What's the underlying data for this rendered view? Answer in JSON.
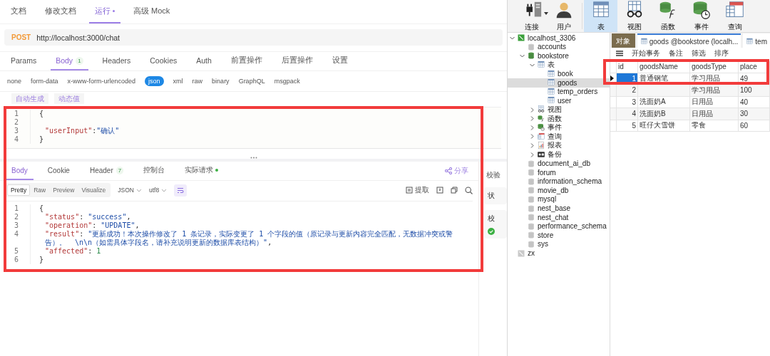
{
  "api_client": {
    "doc_tabs": [
      {
        "label": "文档",
        "selected": false,
        "dot": false
      },
      {
        "label": "修改文档",
        "selected": false,
        "dot": false
      },
      {
        "label": "运行",
        "selected": true,
        "dot": true
      },
      {
        "label": "高级 Mock",
        "selected": false,
        "dot": false
      }
    ],
    "request": {
      "method": "POST",
      "url": "http://localhost:3000/chat"
    },
    "request_tabs": [
      {
        "label": "Params",
        "selected": false
      },
      {
        "label": "Body",
        "badge": "1",
        "selected": true
      },
      {
        "label": "Headers",
        "selected": false
      },
      {
        "label": "Cookies",
        "selected": false
      },
      {
        "label": "Auth",
        "selected": false
      },
      {
        "label": "前置操作",
        "selected": false
      },
      {
        "label": "后置操作",
        "selected": false
      },
      {
        "label": "设置",
        "selected": false
      }
    ],
    "body_types": [
      {
        "label": "none",
        "selected": false
      },
      {
        "label": "form-data",
        "selected": false
      },
      {
        "label": "x-www-form-urlencoded",
        "selected": false
      },
      {
        "label": "json",
        "selected": true
      },
      {
        "label": "xml",
        "selected": false
      },
      {
        "label": "raw",
        "selected": false
      },
      {
        "label": "binary",
        "selected": false
      },
      {
        "label": "GraphQL",
        "selected": false
      },
      {
        "label": "msgpack",
        "selected": false
      }
    ],
    "body_buttons": [
      "自动生成",
      "动态值"
    ],
    "request_body": [
      {
        "num": "1",
        "text": "{"
      },
      {
        "num": "2"
      },
      {
        "num": "3",
        "key": "\"userInput\"",
        "sep": ":",
        "value": "\"确认\""
      },
      {
        "num": "4",
        "text": "}"
      }
    ],
    "response_tabs": [
      {
        "label": "Body",
        "selected": true,
        "dot": false
      },
      {
        "label": "Cookie",
        "selected": false,
        "dot": false
      },
      {
        "label": "Header",
        "badge": "7",
        "selected": false,
        "dot": false
      },
      {
        "label": "控制台",
        "selected": false,
        "dot": false
      },
      {
        "label": "实际请求",
        "selected": false,
        "dot": true
      }
    ],
    "share": "分享",
    "view_modes": [
      {
        "label": "Pretty",
        "selected": true
      },
      {
        "label": "Raw",
        "selected": false
      },
      {
        "label": "Preview",
        "selected": false
      },
      {
        "label": "Visualize",
        "selected": false
      }
    ],
    "format": "JSON",
    "encoding": "utf8",
    "extract": "提取",
    "response_body": [
      {
        "num": "1",
        "text": "{"
      },
      {
        "num": "2",
        "key": "\"status\"",
        "sep": ": ",
        "value": "\"success\"",
        "tail": ","
      },
      {
        "num": "3",
        "key": "\"operation\"",
        "sep": ": ",
        "value": "\"UPDATE\"",
        "tail": ","
      },
      {
        "num": "4",
        "key": "\"result\"",
        "sep": ": ",
        "value": "\"更新成功！本次操作修改了 1 条记录，实际变更了 1 个字段的值（原记录与更新内容完全匹配，无数据冲突或警告）。  \\n\\n（如需具体字段名，请补充说明更新的数据库表结构）\"",
        "tail": ","
      },
      {
        "num": "5",
        "key": "\"affected\"",
        "sep": ": ",
        "number": "1"
      },
      {
        "num": "6",
        "text": "}"
      }
    ],
    "side_panel": {
      "title": "校验",
      "cards": [
        {
          "label": "状",
          "passed": false
        },
        {
          "label": "校",
          "passed": true
        }
      ]
    }
  },
  "db_client": {
    "toolbar": [
      {
        "label": "连接",
        "kind": "plug",
        "selected": false
      },
      {
        "label": "用户",
        "kind": "user",
        "selected": false
      },
      {
        "label": "表",
        "kind": "table",
        "selected": true
      },
      {
        "label": "视图",
        "kind": "view",
        "selected": false
      },
      {
        "label": "函数",
        "kind": "function",
        "selected": false
      },
      {
        "label": "事件",
        "kind": "event",
        "selected": false
      },
      {
        "label": "查询",
        "kind": "query",
        "selected": false
      }
    ],
    "tree": [
      {
        "label": "localhost_3306",
        "kind": "server",
        "expanded": true,
        "selected": false,
        "children": [
          {
            "label": "accounts",
            "kind": "db-off",
            "selected": false
          },
          {
            "label": "bookstore",
            "kind": "db",
            "expanded": true,
            "selected": false,
            "children": [
              {
                "label": "表",
                "kind": "table",
                "expanded": true,
                "selected": false,
                "children": [
                  {
                    "label": "book",
                    "kind": "table",
                    "selected": false
                  },
                  {
                    "label": "goods",
                    "kind": "table",
                    "selected": true
                  },
                  {
                    "label": "temp_orders",
                    "kind": "table",
                    "selected": false
                  },
                  {
                    "label": "user",
                    "kind": "table",
                    "selected": false
                  }
                ]
              },
              {
                "label": "视图",
                "kind": "view",
                "expanded": false,
                "selected": false
              },
              {
                "label": "函数",
                "kind": "function",
                "expanded": false,
                "selected": false
              },
              {
                "label": "事件",
                "kind": "event",
                "expanded": false,
                "selected": false
              },
              {
                "label": "查询",
                "kind": "query",
                "expanded": false,
                "selected": false
              },
              {
                "label": "报表",
                "kind": "report",
                "expanded": false,
                "selected": false
              },
              {
                "label": "备份",
                "kind": "backup",
                "expanded": false,
                "selected": false
              }
            ]
          },
          {
            "label": "document_ai_db",
            "kind": "db-off",
            "selected": false
          },
          {
            "label": "forum",
            "kind": "db-off",
            "selected": false
          },
          {
            "label": "information_schema",
            "kind": "db-off",
            "selected": false
          },
          {
            "label": "movie_db",
            "kind": "db-off",
            "selected": false
          },
          {
            "label": "mysql",
            "kind": "db-off",
            "selected": false
          },
          {
            "label": "nest_base",
            "kind": "db-off",
            "selected": false
          },
          {
            "label": "nest_chat",
            "kind": "db-off",
            "selected": false
          },
          {
            "label": "performance_schema",
            "kind": "db-off",
            "selected": false
          },
          {
            "label": "store",
            "kind": "db-off",
            "selected": false
          },
          {
            "label": "sys",
            "kind": "db-off",
            "selected": false
          }
        ]
      },
      {
        "label": "zx",
        "kind": "server-off",
        "selected": false
      }
    ],
    "tabs": [
      {
        "label": "对象",
        "kind": "objects",
        "selected": false
      },
      {
        "label": "goods @bookstore (localh...",
        "kind": "table",
        "selected": true
      },
      {
        "label": "tem",
        "kind": "table",
        "selected": false
      }
    ],
    "table_toolbar": [
      "开始事务",
      "备注",
      "筛选",
      "排序"
    ],
    "table": {
      "columns": [
        "id",
        "goodsName",
        "goodsType",
        "place"
      ],
      "rows": [
        {
          "selected": true,
          "cells": [
            "1",
            "普通钢笔",
            "学习用品",
            "49"
          ]
        },
        {
          "selected": false,
          "cells": [
            "2",
            null,
            "学习用品",
            "100"
          ]
        },
        {
          "selected": false,
          "cells": [
            "3",
            "洗面奶A",
            "日用品",
            "40"
          ]
        },
        {
          "selected": false,
          "cells": [
            "4",
            "洗面奶B",
            "日用品",
            "30"
          ]
        },
        {
          "selected": false,
          "cells": [
            "5",
            "旺仔大雪饼",
            "零食",
            "60"
          ]
        }
      ]
    }
  },
  "highlight_boxes": [
    {
      "color": "#f23b3b"
    },
    {
      "color": "#f23b3b"
    }
  ]
}
